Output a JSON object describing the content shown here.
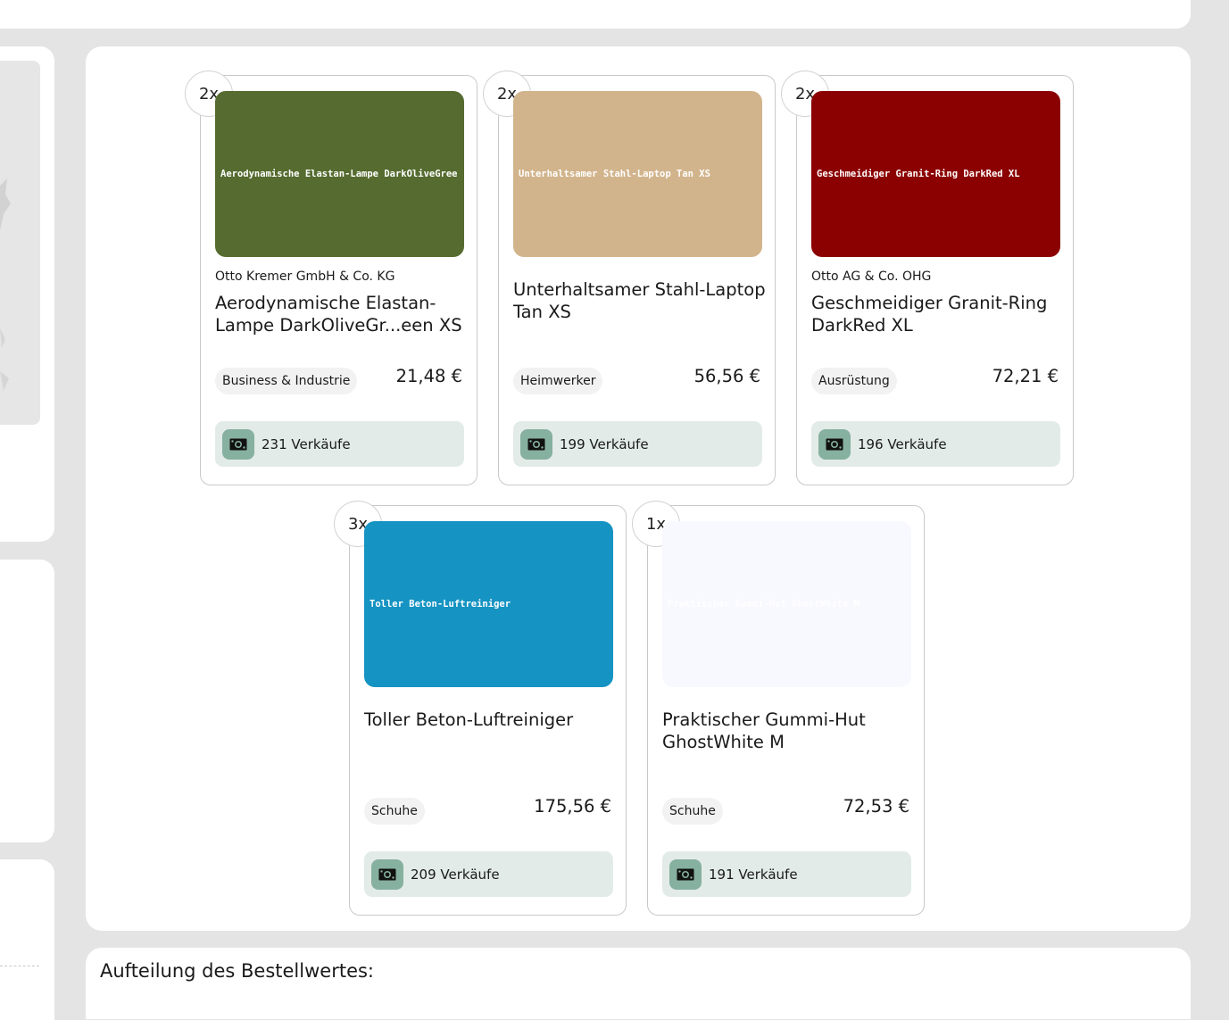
{
  "products": [
    {
      "quantity": "2x",
      "image_color": "#556b2f",
      "image_text": "Aerodynamische Elastan-Lampe DarkOliveGree",
      "image_text_color": "#ffffff",
      "vendor": "Otto Kremer GmbH & Co. KG",
      "title": "Aerodynamische Elastan-Lampe DarkOliveGr...een XS",
      "category": "Business & Industrie",
      "price": "21,48 €",
      "sales_count": "231",
      "sales_label": "Verkäufe"
    },
    {
      "quantity": "2x",
      "image_color": "#d2b48c",
      "image_text": "Unterhaltsamer Stahl-Laptop Tan XS",
      "image_text_color": "#ffffff",
      "vendor": "",
      "title": "Unterhaltsamer Stahl-Laptop Tan XS",
      "category": "Heimwerker",
      "price": "56,56 €",
      "sales_count": "199",
      "sales_label": "Verkäufe"
    },
    {
      "quantity": "2x",
      "image_color": "#8b0000",
      "image_text": "Geschmeidiger Granit-Ring DarkRed XL",
      "image_text_color": "#ffffff",
      "vendor": "Otto AG & Co. OHG",
      "title": "Geschmeidiger Granit-Ring DarkRed XL",
      "category": "Ausrüstung",
      "price": "72,21 €",
      "sales_count": "196",
      "sales_label": "Verkäufe"
    },
    {
      "quantity": "3x",
      "image_color": "#1593c2",
      "image_text": "Toller Beton-Luftreiniger",
      "image_text_color": "#ffffff",
      "vendor": "",
      "title": "Toller Beton-Luftreiniger",
      "category": "Schuhe",
      "price": "175,56 €",
      "sales_count": "209",
      "sales_label": "Verkäufe"
    },
    {
      "quantity": "1x",
      "image_color": "#f8f8ff",
      "image_text": "Praktischer Gummi-Hut GhostWhite M",
      "image_text_color": "#ffffff",
      "vendor": "",
      "title": "Praktischer Gummi-Hut GhostWhite M",
      "category": "Schuhe",
      "price": "72,53 €",
      "sales_count": "191",
      "sales_label": "Verkäufe"
    }
  ],
  "breakdown": {
    "title": "Aufteilung des Bestellwertes:"
  },
  "colors": {
    "page_background": "#e4e4e4",
    "sales_box": "#e2ebe8",
    "money_icon": "#86b09f"
  },
  "icons": {
    "sales": "money-icon"
  }
}
